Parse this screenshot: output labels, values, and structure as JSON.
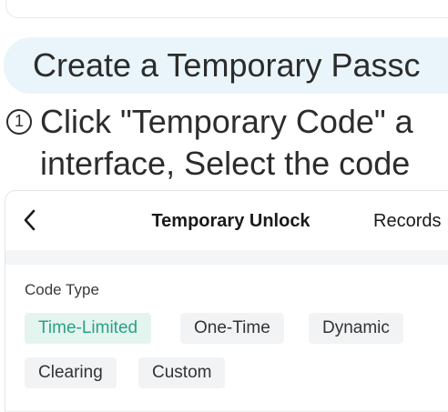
{
  "banner": {
    "title": "Create a Temporary Passc"
  },
  "step": {
    "number": "1",
    "line1": "Click \"Temporary Code\" a",
    "line2": "interface, Select the code"
  },
  "app": {
    "nav": {
      "back_icon": "chevron-left-icon",
      "title": "Temporary Unlock",
      "right_label": "Records"
    },
    "code_type": {
      "label": "Code Type",
      "selected": "Time-Limited",
      "options": [
        "Time-Limited",
        "One-Time",
        "Dynamic",
        "Clearing",
        "Custom"
      ]
    }
  },
  "colors": {
    "banner_bg": "#e9f5fb",
    "accent": "#2aa184",
    "selected_chip_bg": "#e4f4ef",
    "chip_bg": "#f2f3f4"
  }
}
